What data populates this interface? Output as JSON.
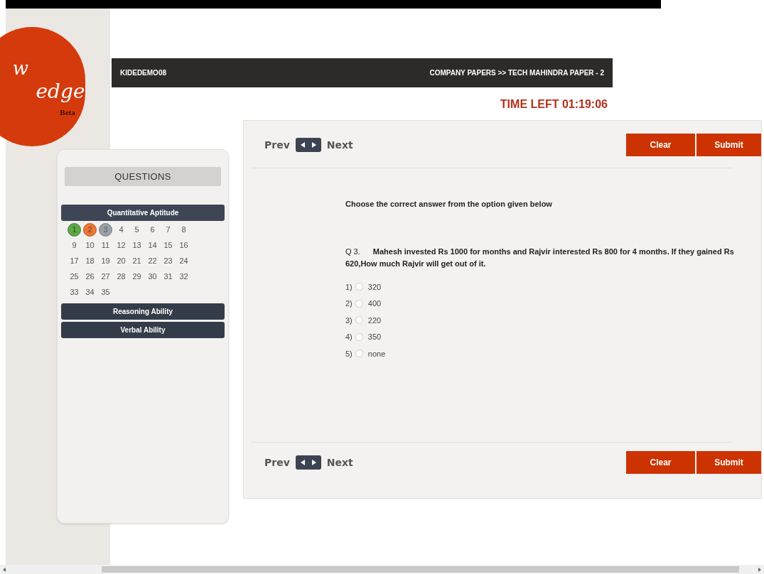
{
  "logo": {
    "line1": "w",
    "line2": "edge",
    "badge": "Beta"
  },
  "header": {
    "user": "KIDEDEMO08",
    "breadcrumb": "COMPANY PAPERS >> TECH MAHINDRA PAPER - 2"
  },
  "timer": "TIME LEFT 01:19:06",
  "sidebar": {
    "title": "QUESTIONS",
    "sections": [
      {
        "label": "Quantitative Aptitude",
        "expanded": true,
        "questions": [
          {
            "number": "1",
            "kind": "answered"
          },
          {
            "number": "2",
            "kind": "review"
          },
          {
            "number": "3",
            "kind": "current"
          },
          {
            "number": "4",
            "kind": "plain"
          },
          {
            "number": "5",
            "kind": "plain"
          },
          {
            "number": "6",
            "kind": "plain"
          },
          {
            "number": "7",
            "kind": "plain"
          },
          {
            "number": "8",
            "kind": "plain"
          },
          {
            "number": "9",
            "kind": "plain"
          },
          {
            "number": "10",
            "kind": "plain"
          },
          {
            "number": "11",
            "kind": "plain"
          },
          {
            "number": "12",
            "kind": "plain"
          },
          {
            "number": "13",
            "kind": "plain"
          },
          {
            "number": "14",
            "kind": "plain"
          },
          {
            "number": "15",
            "kind": "plain"
          },
          {
            "number": "16",
            "kind": "plain"
          },
          {
            "number": "17",
            "kind": "plain"
          },
          {
            "number": "18",
            "kind": "plain"
          },
          {
            "number": "19",
            "kind": "plain"
          },
          {
            "number": "20",
            "kind": "plain"
          },
          {
            "number": "21",
            "kind": "plain"
          },
          {
            "number": "22",
            "kind": "plain"
          },
          {
            "number": "23",
            "kind": "plain"
          },
          {
            "number": "24",
            "kind": "plain"
          },
          {
            "number": "25",
            "kind": "plain"
          },
          {
            "number": "26",
            "kind": "plain"
          },
          {
            "number": "27",
            "kind": "plain"
          },
          {
            "number": "28",
            "kind": "plain"
          },
          {
            "number": "29",
            "kind": "plain"
          },
          {
            "number": "30",
            "kind": "plain"
          },
          {
            "number": "31",
            "kind": "plain"
          },
          {
            "number": "32",
            "kind": "plain"
          },
          {
            "number": "33",
            "kind": "plain"
          },
          {
            "number": "34",
            "kind": "plain"
          },
          {
            "number": "35",
            "kind": "plain"
          }
        ]
      },
      {
        "label": "Reasoning Ability",
        "expanded": false
      },
      {
        "label": "Verbal Ability",
        "expanded": false
      }
    ]
  },
  "nav_top": {
    "prev": "Prev",
    "next": "Next",
    "clear": "Clear",
    "submit": "Submit"
  },
  "instruction": "Choose the correct answer from the option given below",
  "question": {
    "number": "Q 3.",
    "text": "Mahesh invested Rs 1000 for months and Rajvir interested Rs 800 for 4 months. If they gained Rs 620,How much Rajvir will get out of it."
  },
  "options": [
    {
      "index": "1)",
      "label": "320",
      "selected": false
    },
    {
      "index": "2)",
      "label": "400",
      "selected": false
    },
    {
      "index": "3)",
      "label": "220",
      "selected": false
    },
    {
      "index": "4)",
      "label": "350",
      "selected": false
    },
    {
      "index": "5)",
      "label": "none",
      "selected": false
    }
  ],
  "nav_bottom": {
    "prev": "Prev",
    "next": "Next",
    "clear": "Clear",
    "submit": "Submit"
  }
}
